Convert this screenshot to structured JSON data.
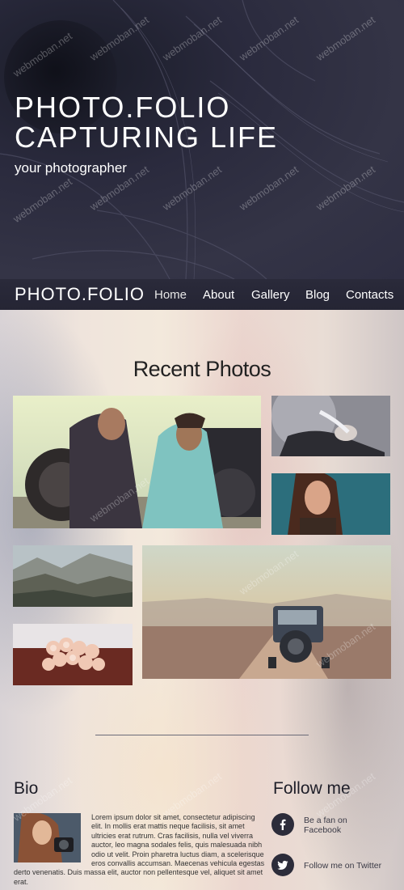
{
  "hero": {
    "title_line1": "PHOTO.FOLIO",
    "title_line2": "CAPTURING LIFE",
    "subtitle": "your photographer"
  },
  "navbar": {
    "logo": "PHOTO.FOLIO",
    "items": [
      {
        "label": "Home",
        "active": true
      },
      {
        "label": "About",
        "active": false
      },
      {
        "label": "Gallery",
        "active": false
      },
      {
        "label": "Blog",
        "active": false
      },
      {
        "label": "Contacts",
        "active": false
      }
    ]
  },
  "recent": {
    "title": "Recent Photos"
  },
  "bio": {
    "title": "Bio",
    "text": "Lorem ipsum dolor sit amet, consectetur adipiscing elit. In mollis erat mattis neque facilisis, sit amet ultricies erat rutrum. Cras facilisis, nulla vel viverra auctor, leo magna sodales felis, quis malesuada nibh odio ut velit. Proin pharetra luctus diam, a scelerisque eros convallis accumsan. Maecenas vehicula egestas derto venenatis. Duis massa elit, auctor non pellentesque vel, aliquet sit amet erat."
  },
  "follow": {
    "title": "Follow me",
    "facebook_line1": "Be a fan on",
    "facebook_line2": "Facebook",
    "twitter": "Follow me on Twitter"
  },
  "watermark": "webmoban.net"
}
